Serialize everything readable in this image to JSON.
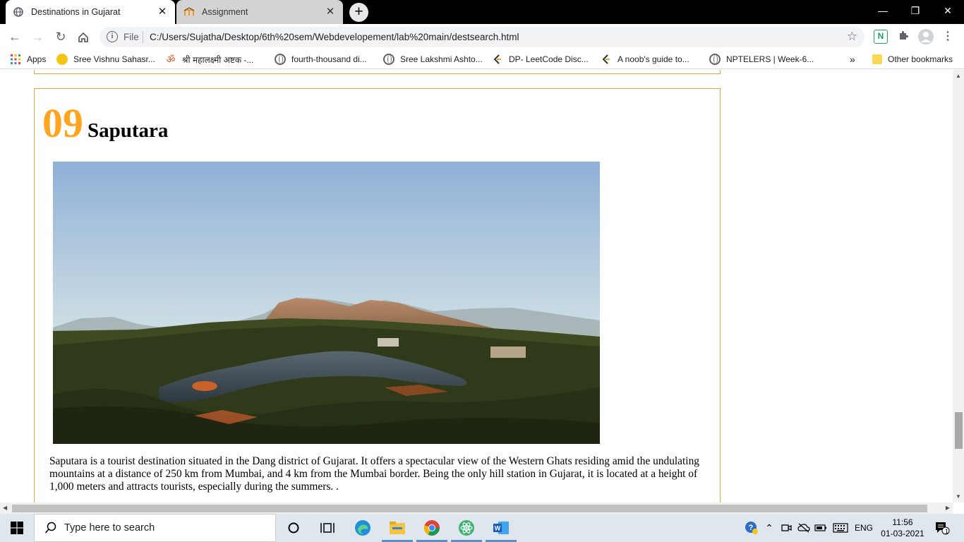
{
  "browser": {
    "tabs": [
      {
        "title": "Destinations in Gujarat",
        "active": true
      },
      {
        "title": "Assignment",
        "active": false
      }
    ],
    "address": {
      "scheme_label": "File",
      "url": "C:/Users/Sujatha/Desktop/6th%20sem/Webdevelopement/lab%20main/destsearch.html"
    },
    "bookmarks": [
      {
        "label": "Apps",
        "icon": "apps-grid-icon"
      },
      {
        "label": "Sree Vishnu Sahasr...",
        "icon": "vishnu-icon"
      },
      {
        "label": "श्री महालक्ष्मी अष्टक -...",
        "icon": "om-icon"
      },
      {
        "label": "fourth-thousand di...",
        "icon": "globe-icon"
      },
      {
        "label": "Sree Lakshmi Ashto...",
        "icon": "globe-icon"
      },
      {
        "label": "DP- LeetCode Disc...",
        "icon": "leetcode-icon"
      },
      {
        "label": "A noob's guide to...",
        "icon": "leetcode-icon"
      },
      {
        "label": "NPTELERS | Week-6...",
        "icon": "globe-icon"
      }
    ],
    "overflow_label": "»",
    "other_bookmarks": "Other bookmarks"
  },
  "page": {
    "destination": {
      "number": "09",
      "name": "Saputara",
      "description": "Saputara is a tourist destination situated in the Dang district of Gujarat. It offers a spectacular view of the Western Ghats residing amid the undulating mountains at a distance of 250 km from Mumbai, and 4 km from the Mumbai border. Being the only hill station in Gujarat, it is located at a height of 1,000 meters and attracts tourists, especially during the summers. ."
    }
  },
  "taskbar": {
    "search_placeholder": "Type here to search",
    "language": "ENG",
    "time": "11:56",
    "date": "01-03-2021",
    "notification_count": "1"
  },
  "colors": {
    "accent_orange": "#ffa51f",
    "card_border": "#e8a33d"
  }
}
